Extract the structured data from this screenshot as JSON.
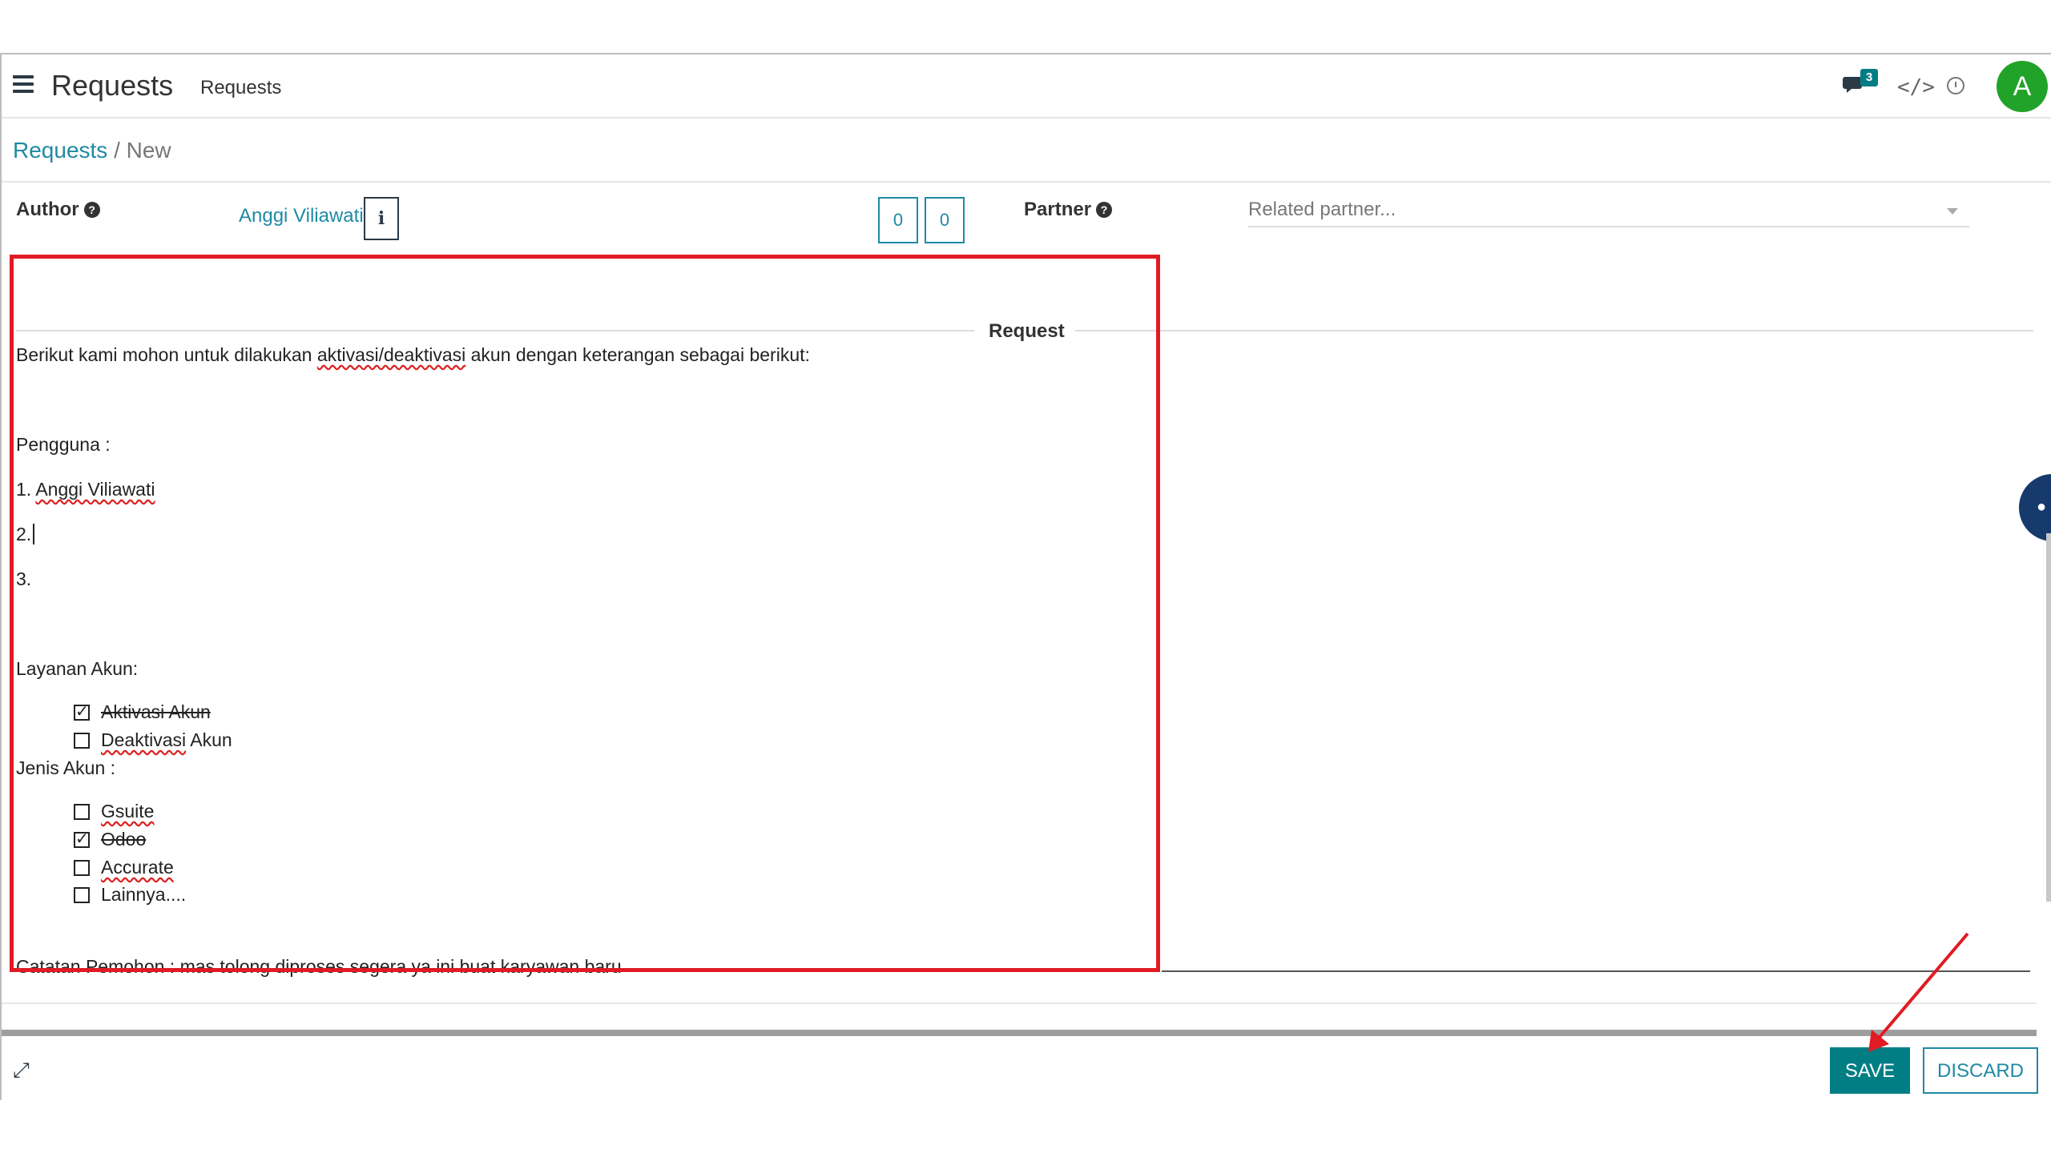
{
  "topbar": {
    "app_title": "Requests",
    "menu_item": "Requests",
    "chat_badge": "3",
    "avatar_letter": "A"
  },
  "breadcrumb": {
    "parent": "Requests",
    "separator": "/",
    "current": "New"
  },
  "form": {
    "author_label": "Author",
    "author_value": "Anggi Viliawati",
    "info_button": "i",
    "count_a": "0",
    "count_b": "0",
    "partner_label": "Partner",
    "partner_placeholder": "Related partner...",
    "section_title": "Request"
  },
  "editor": {
    "intro_prefix": "Berikut kami mohon untuk dilakukan ",
    "intro_sq": "aktivasi/deaktivasi",
    "intro_suffix": " akun dengan keterangan sebagai berikut:",
    "pengguna_label": "Pengguna  :",
    "user1_prefix": "1. ",
    "user1_name": "Anggi Viliawati",
    "user2": "2.",
    "user3": "3.",
    "layanan_label": "Layanan Akun:",
    "layanan_items": [
      {
        "label": "Aktivasi Akun",
        "checked": true
      },
      {
        "label_sq": "Deaktivasi",
        "label_rest": " Akun",
        "checked": false
      }
    ],
    "jenis_label": "Jenis Akun :",
    "jenis_items": [
      {
        "label": "Gsuite",
        "checked": false
      },
      {
        "label": "Odoo",
        "checked": true
      },
      {
        "label": "Accurate",
        "checked": false
      },
      {
        "label": "Lainnya....",
        "checked": false
      }
    ],
    "catatan": "Catatan Pemohon : mas tolong diproses segera ya ini buat karyawan baru"
  },
  "footer": {
    "save_label": "SAVE",
    "discard_label": "DISCARD"
  },
  "colors": {
    "primary": "#017e84",
    "link": "#1f8aa4",
    "highlight": "#e01b24",
    "avatar": "#21a32a"
  }
}
